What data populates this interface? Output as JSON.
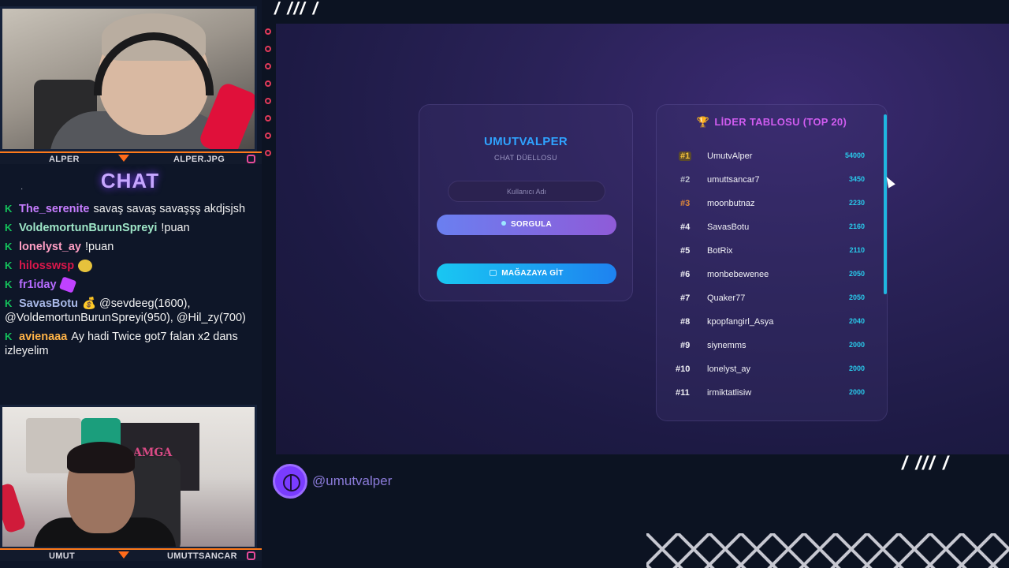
{
  "overlay": {
    "streamer_top_name_left": "ALPER",
    "streamer_top_name_right": "ALPER.JPG",
    "streamer_bottom_name_left": "UMUT",
    "streamer_bottom_name_right": "UMUTTSANCAR",
    "chat_title": "CHAT",
    "top_slashes": "/ /// /",
    "bottom_slashes": "/ /// /",
    "social_handle": "@umutvalper",
    "banner_text": "AMGA"
  },
  "chat": {
    "messages": [
      {
        "user": "The_serenite",
        "color": "#c77dff",
        "text": "savaş savaş savaşşş akdjsjsh"
      },
      {
        "user": "VoldemortunBurunSpreyi",
        "color": "#9fe7c8",
        "text": "!puan"
      },
      {
        "user": "lonelyst_ay",
        "color": "#ff9fc4",
        "text": "!puan"
      },
      {
        "user": "hilosswsp",
        "color": "#d8174a",
        "text": ""
      },
      {
        "user": "fr1iday",
        "color": "#b66bff",
        "text": ""
      },
      {
        "user": "SavasBotu",
        "color": "#a9b9e8",
        "text": "💰 @sevdeeg(1600), @VoldemortunBurunSpreyi(950), @Hil_zy(700)"
      },
      {
        "user": "avienaaa",
        "color": "#ffb347",
        "text": "Ay hadi Twice got7 falan x2 dans izleyelim"
      }
    ]
  },
  "login": {
    "title": "UMUTVALPER",
    "subtitle": "CHAT DÜELLOSU",
    "input_placeholder": "Kullanıcı Adı",
    "input_value": "",
    "query_button": "SORGULA",
    "store_button": "MAĞAZAYA GİT"
  },
  "leaderboard": {
    "title": "LİDER TABLOSU (TOP 20)",
    "entries": [
      {
        "rank": "#1",
        "name": "UmutvAlper",
        "score": "54000"
      },
      {
        "rank": "#2",
        "name": "umuttsancar7",
        "score": "3450"
      },
      {
        "rank": "#3",
        "name": "moonbutnaz",
        "score": "2230"
      },
      {
        "rank": "#4",
        "name": "SavasBotu",
        "score": "2160"
      },
      {
        "rank": "#5",
        "name": "BotRix",
        "score": "2110"
      },
      {
        "rank": "#6",
        "name": "monbebewenee",
        "score": "2050"
      },
      {
        "rank": "#7",
        "name": "Quaker77",
        "score": "2050"
      },
      {
        "rank": "#8",
        "name": "kpopfangirl_Asya",
        "score": "2040"
      },
      {
        "rank": "#9",
        "name": "siynemms",
        "score": "2000"
      },
      {
        "rank": "#10",
        "name": "lonelyst_ay",
        "score": "2000"
      },
      {
        "rank": "#11",
        "name": "irmiktatlisiw",
        "score": "2000"
      }
    ]
  }
}
